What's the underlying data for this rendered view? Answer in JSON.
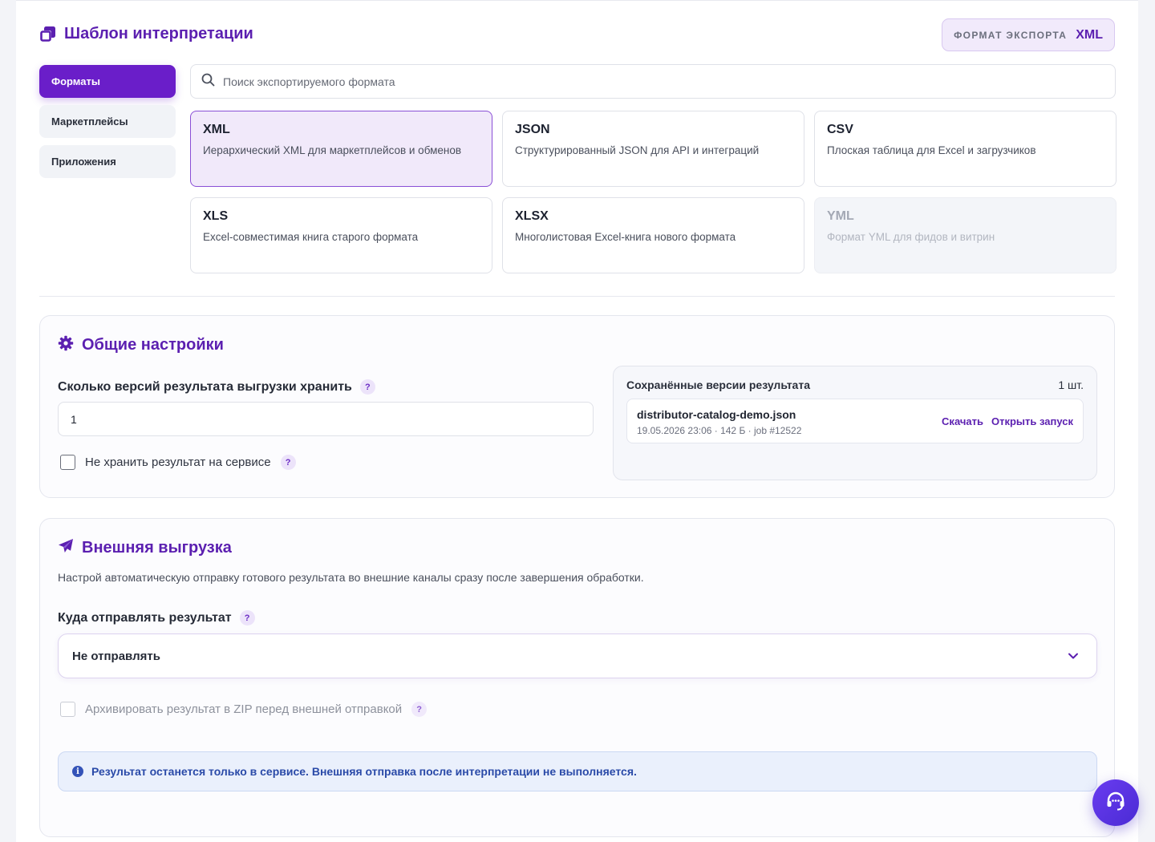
{
  "header": {
    "title": "Шаблон интерпретации",
    "export_label": "ФОРМАТ ЭКСПОРТА",
    "export_value": "XML"
  },
  "sidebar": {
    "items": [
      {
        "label": "Форматы",
        "active": true
      },
      {
        "label": "Маркетплейсы",
        "active": false
      },
      {
        "label": "Приложения",
        "active": false
      }
    ]
  },
  "search": {
    "placeholder": "Поиск экспортируемого формата",
    "value": ""
  },
  "formats": [
    {
      "name": "XML",
      "description": "Иерархический XML для маркетплейсов и обменов",
      "state": "selected"
    },
    {
      "name": "JSON",
      "description": "Структурированный JSON для API и интеграций",
      "state": "normal"
    },
    {
      "name": "CSV",
      "description": "Плоская таблица для Excel и загрузчиков",
      "state": "normal"
    },
    {
      "name": "XLS",
      "description": "Excel-совместимая книга старого формата",
      "state": "normal"
    },
    {
      "name": "XLSX",
      "description": "Многолистовая Excel-книга нового формата",
      "state": "normal"
    },
    {
      "name": "YML",
      "description": "Формат YML для фидов и витрин",
      "state": "disabled"
    }
  ],
  "general": {
    "title": "Общие настройки",
    "versions_label": "Сколько версий результата выгрузки хранить",
    "versions_value": "1",
    "help_glyph": "?",
    "no_store_label": "Не хранить результат на сервисе",
    "no_store_checked": false,
    "saved": {
      "title": "Сохранённые версии результата",
      "count": "1 шт.",
      "item": {
        "filename": "distributor-catalog-demo.json",
        "meta": "19.05.2026 23:06 · 142 Б · job #12522",
        "download": "Скачать",
        "open_run": "Открыть запуск"
      }
    }
  },
  "external": {
    "title": "Внешняя выгрузка",
    "description": "Настрой автоматическую отправку готового результата во внешние каналы сразу после завершения обработки.",
    "destination_label": "Куда отправлять результат",
    "destination_value": "Не отправлять",
    "zip_label": "Архивировать результат в ZIP перед внешней отправкой",
    "zip_checked": false,
    "info_glyph": "i",
    "info_text": "Результат останется только в сервисе. Внешняя отправка после интерпретации не выполняется."
  },
  "colors": {
    "accent": "#5b1fb0",
    "accent_strong": "#6a1ec9",
    "info_text": "#2a4aa8",
    "info_bg": "#eaf0fc"
  },
  "icons": {
    "title": "copy-icon",
    "search": "search-icon",
    "general": "gear-icon",
    "external": "paper-plane-icon",
    "select": "chevron-down-icon",
    "info": "info-icon",
    "fab": "headset-icon"
  }
}
